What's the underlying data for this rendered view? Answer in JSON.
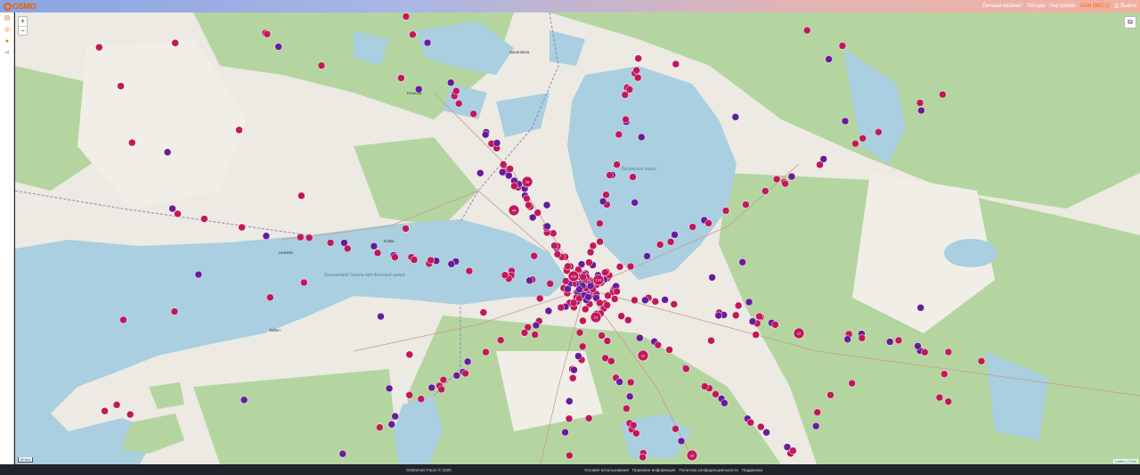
{
  "app": {
    "logo_text": "OSMO"
  },
  "header": {
    "nav": [
      "Личный кабинет",
      "Погода",
      "Настройки"
    ],
    "gold": "Gold (862.1)",
    "exit": "Выйти"
  },
  "sidebar": {
    "icons": [
      "layers-icon",
      "locate-icon",
      "pin-icon",
      "share-icon"
    ]
  },
  "map": {
    "zoom_in": "+",
    "zoom_out": "−",
    "scale_label": "20 km",
    "attribution": "Leaflet | OSM",
    "water_labels": [
      "Ладожское озеро",
      "Suomenlahti Soome laht Финский залив"
    ],
    "place_labels": [
      "Savonlinna",
      "Kotka",
      "Helsinki",
      "Tallinn",
      "Kouvola"
    ],
    "colors": {
      "water": "#a9cfe0",
      "land": "#f1eee8",
      "forest": "#b4d5a0",
      "red_marker": "#c2185b",
      "purple_marker": "#6a1b9a"
    },
    "cluster_counts": [
      "216",
      "134",
      "44",
      "28",
      "11",
      "10",
      "12",
      "18"
    ]
  },
  "footer": {
    "copyright": "OsMomolo Fauro © 2020",
    "links": [
      "Условия использования",
      "Правовая информация",
      "Политика конфиденциальности",
      "Поддержка"
    ]
  }
}
